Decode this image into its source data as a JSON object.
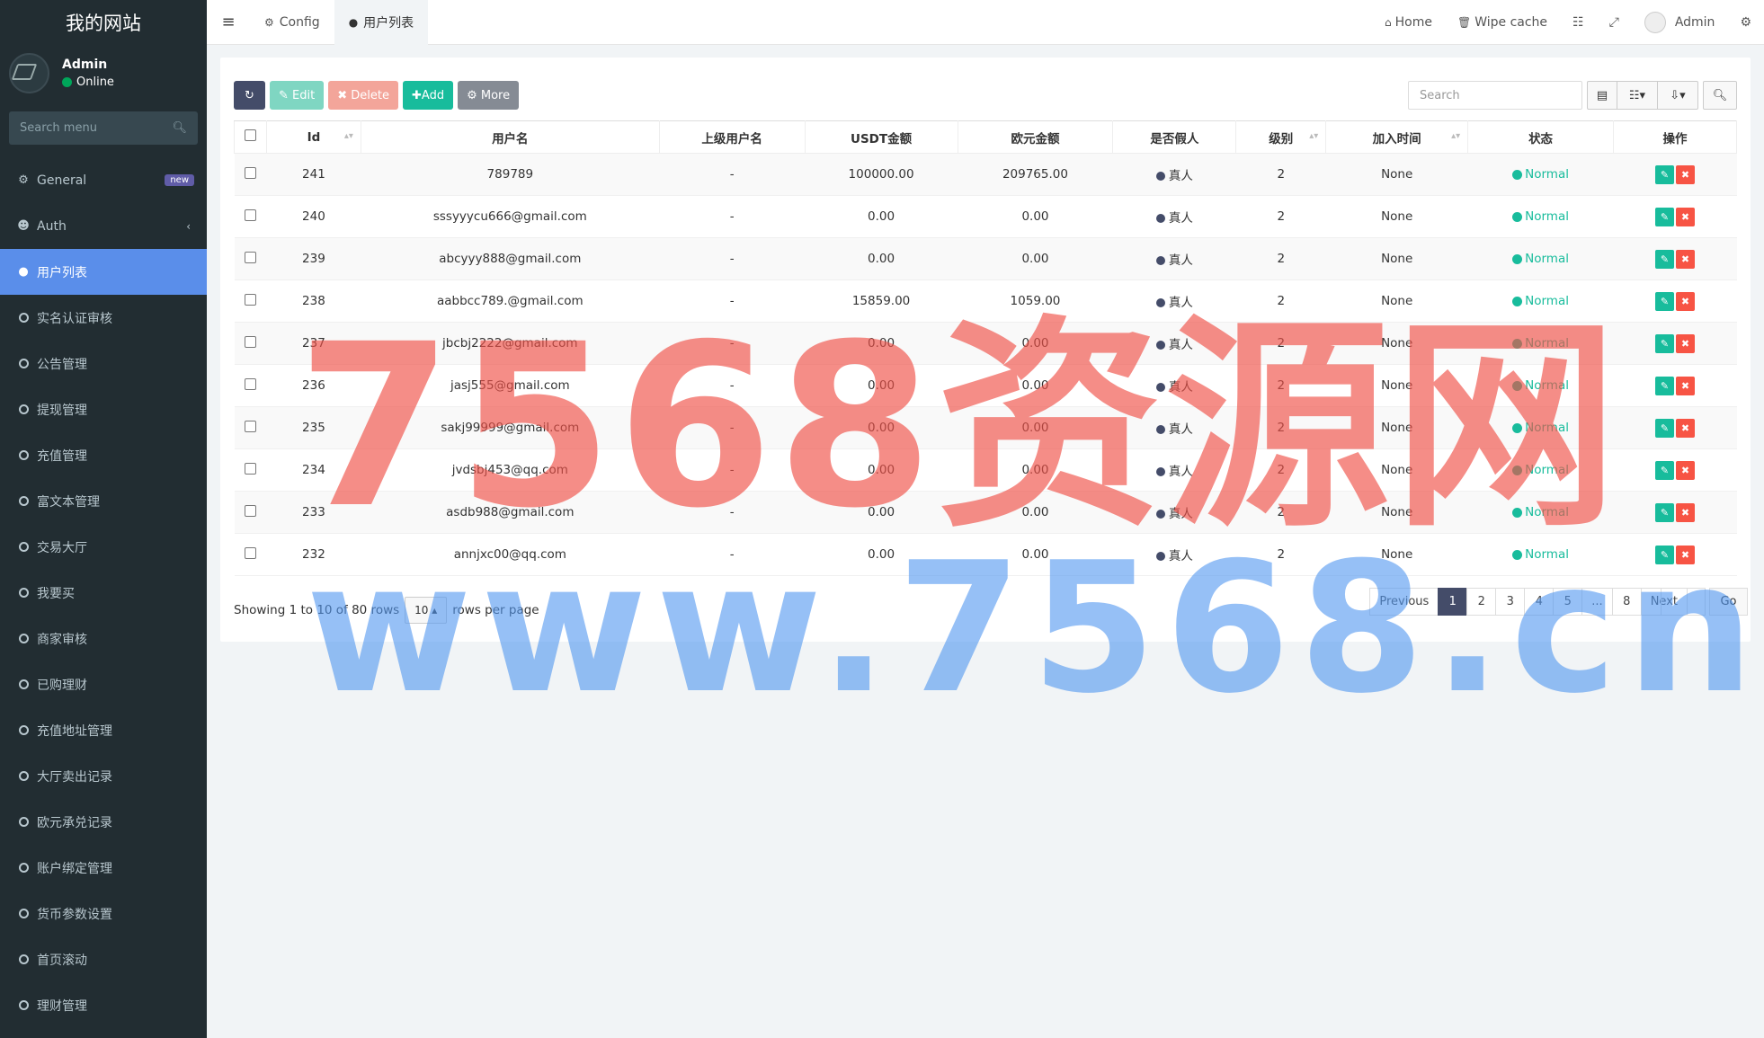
{
  "site": {
    "title": "我的网站"
  },
  "user": {
    "name": "Admin",
    "status": "Online"
  },
  "sidebar": {
    "search_placeholder": "Search menu",
    "general": {
      "label": "General",
      "badge": "new"
    },
    "auth": {
      "label": "Auth"
    },
    "items": [
      "用户列表",
      "实名认证审核",
      "公告管理",
      "提现管理",
      "充值管理",
      "富文本管理",
      "交易大厅",
      "我要买",
      "商家审核",
      "已购理财",
      "充值地址管理",
      "大厅卖出记录",
      "欧元承兑记录",
      "账户绑定管理",
      "货币参数设置",
      "首页滚动",
      "理财管理"
    ]
  },
  "header": {
    "tabs": [
      "Config",
      "用户列表"
    ],
    "home": "Home",
    "wipe": "Wipe cache",
    "admin": "Admin"
  },
  "toolbar": {
    "edit": "Edit",
    "delete": "Delete",
    "add": "Add",
    "more": "More",
    "search_placeholder": "Search"
  },
  "table": {
    "columns": [
      "Id",
      "用户名",
      "上级用户名",
      "USDT金额",
      "欧元金额",
      "是否假人",
      "级别",
      "加入时间",
      "状态",
      "操作"
    ],
    "rows": [
      {
        "id": "241",
        "username": "789789",
        "parent": "-",
        "usdt": "100000.00",
        "eur": "209765.00",
        "fake": "真人",
        "level": "2",
        "joined": "None",
        "status": "Normal"
      },
      {
        "id": "240",
        "username": "sssyyycu666@gmail.com",
        "parent": "-",
        "usdt": "0.00",
        "eur": "0.00",
        "fake": "真人",
        "level": "2",
        "joined": "None",
        "status": "Normal"
      },
      {
        "id": "239",
        "username": "abcyyy888@gmail.com",
        "parent": "-",
        "usdt": "0.00",
        "eur": "0.00",
        "fake": "真人",
        "level": "2",
        "joined": "None",
        "status": "Normal"
      },
      {
        "id": "238",
        "username": "aabbcc789.@gmail.com",
        "parent": "-",
        "usdt": "15859.00",
        "eur": "1059.00",
        "fake": "真人",
        "level": "2",
        "joined": "None",
        "status": "Normal"
      },
      {
        "id": "237",
        "username": "jbcbj2222@gmail.com",
        "parent": "-",
        "usdt": "0.00",
        "eur": "0.00",
        "fake": "真人",
        "level": "2",
        "joined": "None",
        "status": "Normal"
      },
      {
        "id": "236",
        "username": "jasj555@gmail.com",
        "parent": "-",
        "usdt": "0.00",
        "eur": "0.00",
        "fake": "真人",
        "level": "2",
        "joined": "None",
        "status": "Normal"
      },
      {
        "id": "235",
        "username": "sakj99999@gmail.com",
        "parent": "-",
        "usdt": "0.00",
        "eur": "0.00",
        "fake": "真人",
        "level": "2",
        "joined": "None",
        "status": "Normal"
      },
      {
        "id": "234",
        "username": "jvdsbj453@qq.com",
        "parent": "-",
        "usdt": "0.00",
        "eur": "0.00",
        "fake": "真人",
        "level": "2",
        "joined": "None",
        "status": "Normal"
      },
      {
        "id": "233",
        "username": "asdb988@gmail.com",
        "parent": "-",
        "usdt": "0.00",
        "eur": "0.00",
        "fake": "真人",
        "level": "2",
        "joined": "None",
        "status": "Normal"
      },
      {
        "id": "232",
        "username": "annjxc00@qq.com",
        "parent": "-",
        "usdt": "0.00",
        "eur": "0.00",
        "fake": "真人",
        "level": "2",
        "joined": "None",
        "status": "Normal"
      }
    ]
  },
  "footer": {
    "showing": "Showing 1 to 10 of 80 rows",
    "per_page": "10",
    "rows_per_page": "rows per page",
    "pages": [
      "Previous",
      "1",
      "2",
      "3",
      "4",
      "5",
      "...",
      "8",
      "Next"
    ],
    "go": "Go"
  },
  "watermark": {
    "line1": "7568资源网",
    "line2": "www.7568.cn"
  },
  "colors": {
    "sidebar": "#222d32",
    "active": "#5a8eea",
    "primary": "#444c69",
    "success": "#18bc9c",
    "danger": "#f75444"
  }
}
